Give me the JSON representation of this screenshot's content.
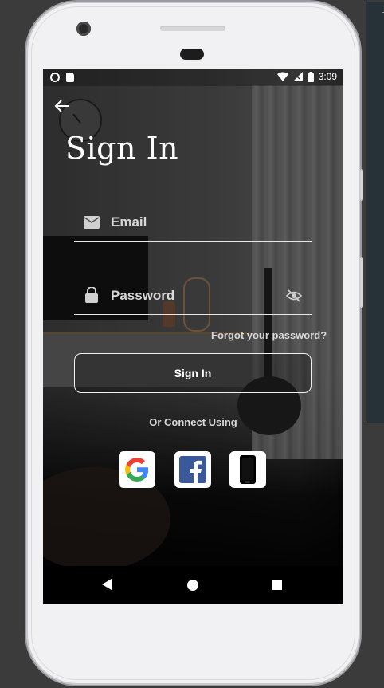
{
  "status_bar": {
    "time": "3:09"
  },
  "screen": {
    "title": "Sign In",
    "email": {
      "placeholder": "Email",
      "value": ""
    },
    "password": {
      "placeholder": "Password",
      "value": ""
    },
    "forgot_link": "Forgot your password?",
    "signin_button": "Sign In",
    "or_connect": "Or Connect Using",
    "social": [
      {
        "name": "google",
        "icon": "google-icon"
      },
      {
        "name": "facebook",
        "icon": "facebook-icon"
      },
      {
        "name": "phone",
        "icon": "phone-icon"
      }
    ]
  },
  "colors": {
    "accent": "#ffffff",
    "facebook": "#3b5998",
    "google_blue": "#4285F4",
    "google_red": "#EA4335",
    "google_yellow": "#FBBC05",
    "google_green": "#34A853"
  }
}
